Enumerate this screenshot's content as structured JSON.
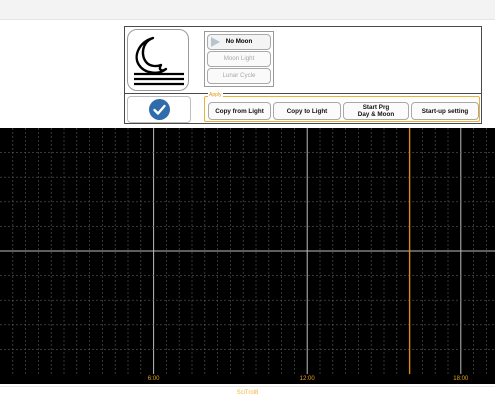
{
  "moon_modes": [
    {
      "label": "No Moon",
      "active": true
    },
    {
      "label": "Moon Light",
      "active": false
    },
    {
      "label": "Lunar Cycle",
      "active": false
    }
  ],
  "apply": {
    "legend": "Apply",
    "buttons": [
      {
        "label": "Copy  from  Light"
      },
      {
        "label": "Copy  to  Light"
      },
      {
        "label": "Start Prg\nDay & Moon"
      },
      {
        "label": "Start-up setting"
      }
    ]
  },
  "chart_data": {
    "type": "line",
    "x_ticks": [
      "6:00",
      "12:00",
      "18:00"
    ],
    "series": [],
    "grid": true,
    "marker_time": "16:00",
    "marker_color": "#d98a1a"
  },
  "footer": {
    "label": "SciTrol8"
  },
  "colors": {
    "accent": "#2f6cab",
    "apply_border": "#e8b13a",
    "tick_label": "#e8a01c",
    "chart_bg": "#000000"
  }
}
